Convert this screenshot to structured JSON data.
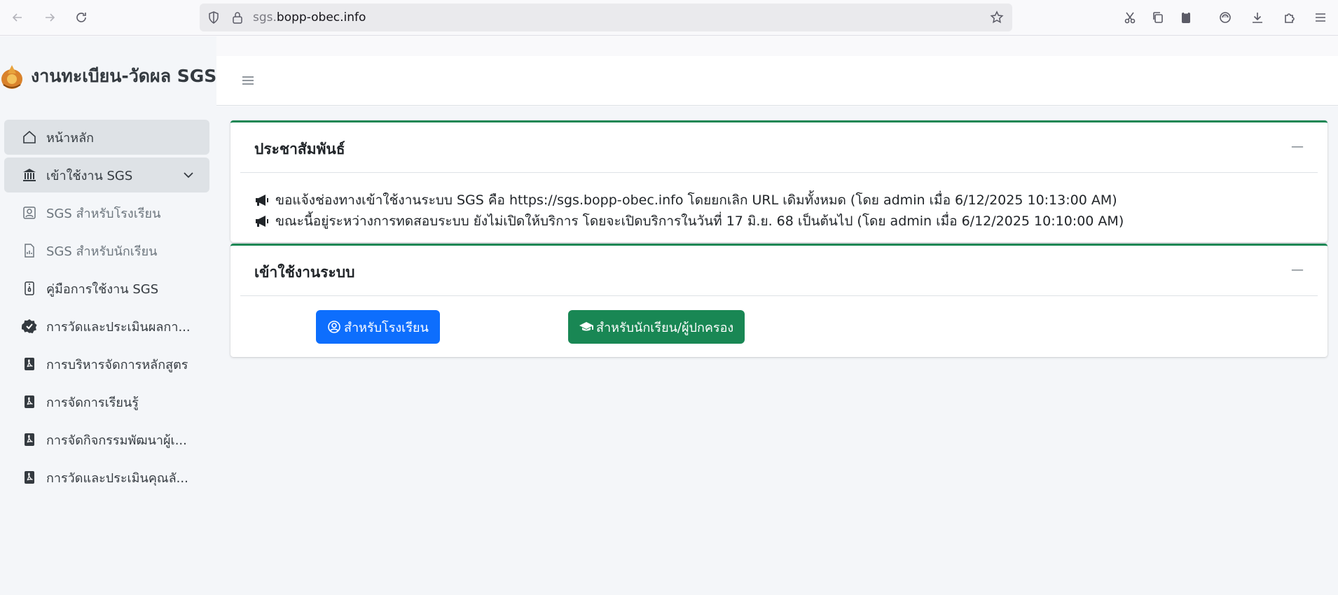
{
  "browser": {
    "url_prefix": "sgs.",
    "url_domain": "bopp-obec.info"
  },
  "brand": {
    "title": "งานทะเบียน-วัดผล SGS"
  },
  "sidebar": {
    "items": [
      {
        "label": "หน้าหลัก",
        "icon": "house-icon"
      },
      {
        "label": "เข้าใช้งาน SGS",
        "icon": "bank-icon"
      },
      {
        "label": "SGS สำหรับโรงเรียน",
        "icon": "person-badge-icon"
      },
      {
        "label": "SGS สำหรับนักเรียน",
        "icon": "chart-file-icon"
      },
      {
        "label": "คู่มือการใช้งาน SGS",
        "icon": "file-zip-icon"
      },
      {
        "label": "การวัดและประเมินผลกา...",
        "icon": "patch-check-icon"
      },
      {
        "label": "การบริหารจัดการหลักสูตร",
        "icon": "file-pdf-icon"
      },
      {
        "label": "การจัดการเรียนรู้",
        "icon": "file-pdf-icon"
      },
      {
        "label": "การจัดกิจกรรมพัฒนาผู้เ...",
        "icon": "file-pdf-icon"
      },
      {
        "label": "การวัดและประเมินคุณลั...",
        "icon": "file-pdf-icon"
      }
    ]
  },
  "announcements": {
    "title": "ประชาสัมพันธ์",
    "items": [
      "ขอแจ้งช่องทางเข้าใช้งานระบบ SGS คือ https://sgs.bopp-obec.info โดยยกเลิก URL เดิมทั้งหมด (โดย admin เมื่อ 6/12/2025 10:13:00 AM)",
      "ขณะนี้อยู่ระหว่างการทดสอบระบบ ยังไม่เปิดให้บริการ โดยจะเปิดบริการในวันที่ 17 มิ.ย. 68 เป็นต้นไป (โดย admin เมื่อ 6/12/2025 10:10:00 AM)"
    ]
  },
  "login": {
    "title": "เข้าใช้งานระบบ",
    "school_button": "สำหรับโรงเรียน",
    "student_button": "สำหรับนักเรียน/ผู้ปกครอง"
  },
  "colors": {
    "accent_green": "#198754",
    "primary_blue": "#0d6efd"
  }
}
